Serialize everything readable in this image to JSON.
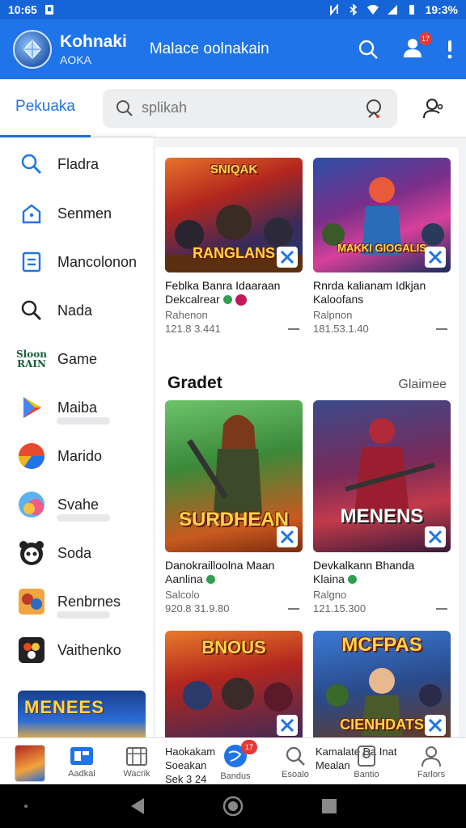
{
  "status": {
    "time": "10:65",
    "right": "19:3%"
  },
  "colors": {
    "primary": "#1e74e8",
    "status_bar": "#1565d8",
    "badge": "#e53935"
  },
  "header": {
    "app_name": "Kohnaki",
    "app_sub": "AOKA",
    "subtitle": "Malace oolnakain",
    "notification_count": "17",
    "icons": [
      "search-icon",
      "account-icon",
      "more-vert-icon"
    ]
  },
  "tabs": {
    "active": "Pekuaka"
  },
  "search": {
    "placeholder": "splikah"
  },
  "sidebar": {
    "items": [
      {
        "label": "Fladra",
        "icon": "search-icon"
      },
      {
        "label": "Senmen",
        "icon": "home-icon"
      },
      {
        "label": "Mancolonon",
        "icon": "list-icon"
      },
      {
        "label": "Nada",
        "icon": "search-icon"
      },
      {
        "label": "Game",
        "icon": "game-logo-icon",
        "icon_text": "Sloon RAIN"
      },
      {
        "label": "Maiba",
        "icon": "play-store-icon"
      },
      {
        "label": "Marido",
        "icon": "circle-app-icon"
      },
      {
        "label": "Svahe",
        "icon": "colorful-app-icon"
      },
      {
        "label": "Soda",
        "icon": "panda-icon"
      },
      {
        "label": "Renbrnes",
        "icon": "game-thumb-icon"
      },
      {
        "label": "Vaithenko",
        "icon": "soda-icon"
      }
    ],
    "banner_text": "MENEES"
  },
  "cards": [
    {
      "art_text": "RANGLANS",
      "top_text": "SNIQAK",
      "title": "Feblka Banra Idaaraan",
      "subtitle": "Dekcalrear",
      "meta": "Rahenon",
      "number": "121.8 3.441"
    },
    {
      "art_text": "MAKKI GIOGALIS",
      "title": "Rnrda kalianam Idkjan",
      "subtitle": "Kaloofans",
      "meta": "Ralpnon",
      "number": "181.53.1.40"
    },
    {
      "art_text": "SURDHEAN",
      "title": "Danokrailloolna Maan",
      "subtitle": "Aanlina",
      "meta": "Salcolo",
      "number": "920.8 31.9.80"
    },
    {
      "art_text": "MENENS",
      "title": "Devkalkann Bhanda",
      "subtitle": "Klaina",
      "meta": "Ralgno",
      "number": "121.15.300"
    },
    {
      "art_text": "BNOUS"
    },
    {
      "art_text": "MCFPAS",
      "bottom_text": "CIENHDATS"
    }
  ],
  "section": {
    "title": "Gradet",
    "more": "Glaimee"
  },
  "bottom_nav": {
    "items": [
      {
        "label": "Aadkal",
        "icon": "video-icon"
      },
      {
        "label": "Wacrik",
        "icon": "calendar-icon"
      },
      {
        "label": "Bandus",
        "icon": "globe-icon"
      },
      {
        "label": "Esoalo",
        "icon": "search-icon"
      },
      {
        "label": "Bantio",
        "icon": "badge-icon"
      },
      {
        "label": "Farlors",
        "icon": "person-icon"
      }
    ],
    "badge": "17",
    "mini_line1": "Haokakam",
    "mini_line2": "Soeakan",
    "mini_line3": "Sek 3 24",
    "mini2_line1": "Kamalate Da Inat",
    "mini2_line2": "Mealan"
  }
}
